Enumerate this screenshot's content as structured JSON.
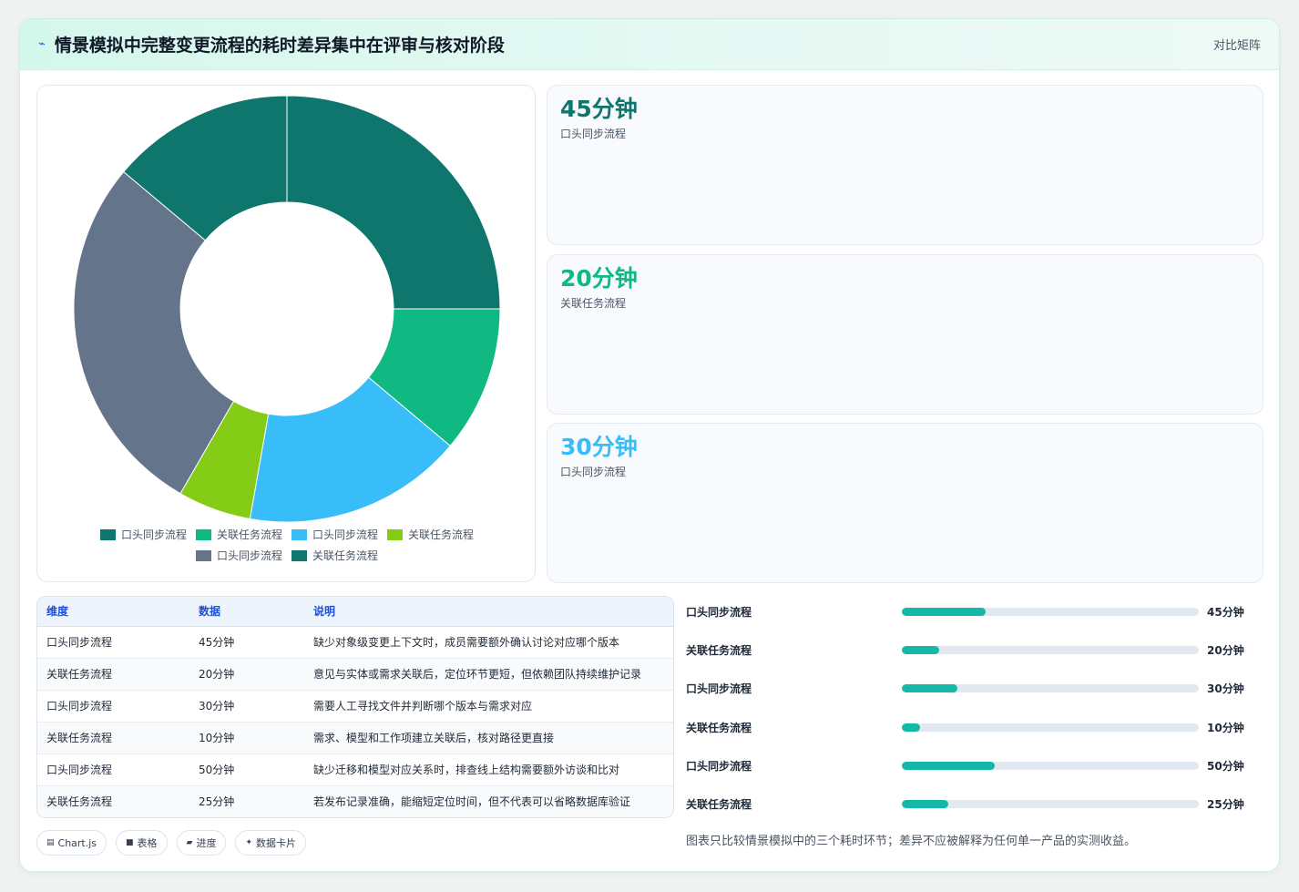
{
  "header": {
    "icon": "lightning-icon",
    "title": "情景模拟中完整变更流程的耗时差异集中在评审与核对阶段",
    "right_label": "对比矩阵"
  },
  "chart_data": {
    "type": "pie",
    "categories": [
      "口头同步流程",
      "关联任务流程",
      "口头同步流程",
      "关联任务流程",
      "口头同步流程",
      "关联任务流程"
    ],
    "values": [
      45,
      20,
      30,
      10,
      50,
      25
    ],
    "units": "分钟",
    "colors": [
      "#0f766e",
      "#10b981",
      "#38bdf8",
      "#84cc16",
      "#64748b",
      "#0f766e"
    ],
    "legend": "bottom",
    "donut": true
  },
  "stats": [
    {
      "value": "45分钟",
      "label": "口头同步流程",
      "color": "#0f766e"
    },
    {
      "value": "20分钟",
      "label": "关联任务流程",
      "color": "#10b981"
    },
    {
      "value": "30分钟",
      "label": "口头同步流程",
      "color": "#38bdf8"
    }
  ],
  "table": {
    "headers": [
      "维度",
      "数据",
      "说明"
    ],
    "rows": [
      [
        "口头同步流程",
        "45分钟",
        "缺少对象级变更上下文时，成员需要额外确认讨论对应哪个版本"
      ],
      [
        "关联任务流程",
        "20分钟",
        "意见与实体或需求关联后，定位环节更短，但依赖团队持续维护记录"
      ],
      [
        "口头同步流程",
        "30分钟",
        "需要人工寻找文件并判断哪个版本与需求对应"
      ],
      [
        "关联任务流程",
        "10分钟",
        "需求、模型和工作项建立关联后，核对路径更直接"
      ],
      [
        "口头同步流程",
        "50分钟",
        "缺少迁移和模型对应关系时，排查线上结构需要额外访谈和比对"
      ],
      [
        "关联任务流程",
        "25分钟",
        "若发布记录准确，能缩短定位时间，但不代表可以省略数据库验证"
      ]
    ]
  },
  "bars": {
    "max": 160,
    "items": [
      {
        "label": "口头同步流程",
        "value": 45,
        "text": "45分钟"
      },
      {
        "label": "关联任务流程",
        "value": 20,
        "text": "20分钟"
      },
      {
        "label": "口头同步流程",
        "value": 30,
        "text": "30分钟"
      },
      {
        "label": "关联任务流程",
        "value": 10,
        "text": "10分钟"
      },
      {
        "label": "口头同步流程",
        "value": 50,
        "text": "50分钟"
      },
      {
        "label": "关联任务流程",
        "value": 25,
        "text": "25分钟"
      }
    ],
    "note": "图表只比较情景模拟中的三个耗时环节；差异不应被解释为任何单一产品的实测收益。"
  },
  "chips": [
    {
      "icon": "chart-icon",
      "glyph": "▤",
      "label": "Chart.js"
    },
    {
      "icon": "table-icon",
      "glyph": "■",
      "label": "表格"
    },
    {
      "icon": "progress-icon",
      "glyph": "▰",
      "label": "进度"
    },
    {
      "icon": "card-icon",
      "glyph": "✦",
      "label": "数据卡片"
    }
  ]
}
